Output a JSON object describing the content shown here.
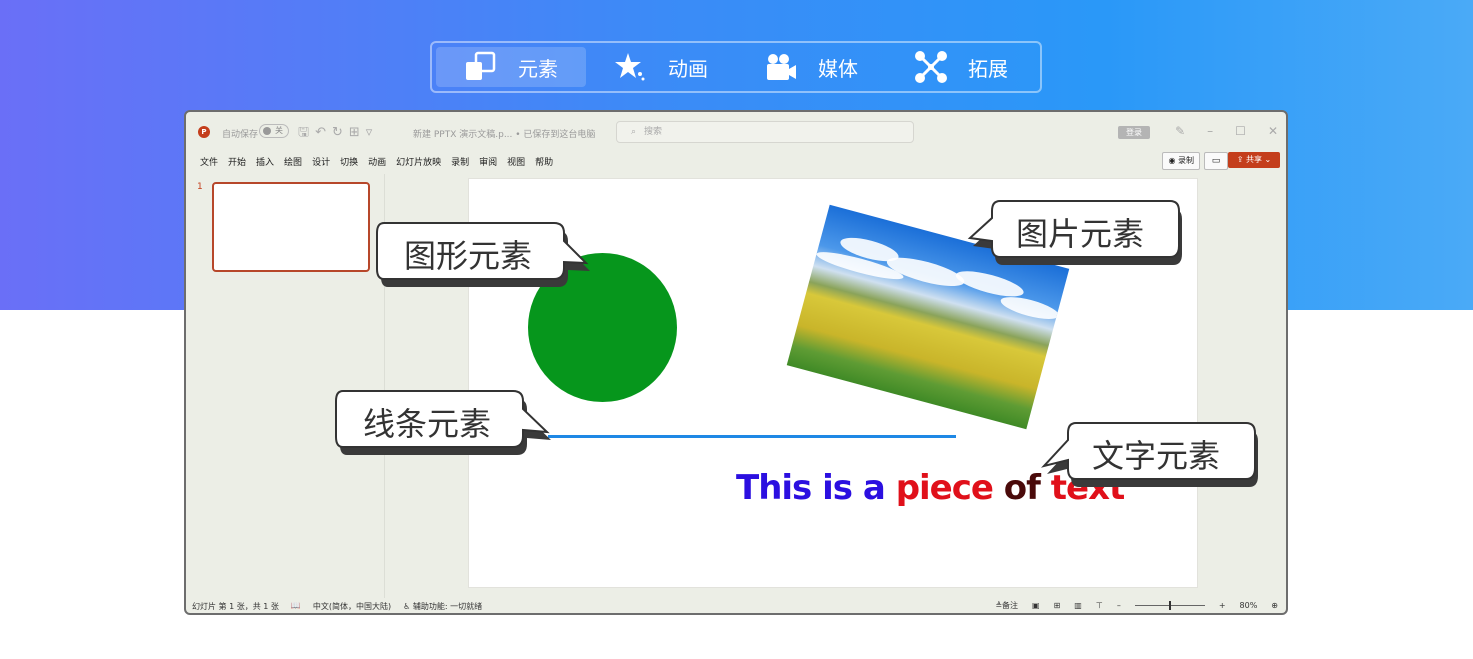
{
  "tabs": [
    {
      "label": "元素",
      "icon": "elements-icon",
      "active": true
    },
    {
      "label": "动画",
      "icon": "animation-star-icon",
      "active": false
    },
    {
      "label": "媒体",
      "icon": "video-camera-icon",
      "active": false
    },
    {
      "label": "拓展",
      "icon": "extension-network-icon",
      "active": false
    }
  ],
  "window": {
    "autosave_label": "自动保存",
    "autosave_state": "关",
    "doc_title": "新建 PPTX 演示文稿.p... • 已保存到这台电脑",
    "search_placeholder": "搜索",
    "login_label": "登录",
    "menu": [
      "文件",
      "开始",
      "插入",
      "绘图",
      "设计",
      "切换",
      "动画",
      "幻灯片放映",
      "录制",
      "审阅",
      "视图",
      "帮助"
    ],
    "record_label": "录制",
    "share_label": "共享",
    "slide_number": "1"
  },
  "status": {
    "slide_info": "幻灯片 第 1 张，共 1 张",
    "language": "中文(简体，中国大陆)",
    "accessibility": "辅助功能: 一切就绪",
    "notes": "备注",
    "zoom": "80%"
  },
  "slide": {
    "text_words": [
      {
        "text": "This",
        "color": "#2b0fe0"
      },
      {
        "text": "is",
        "color": "#2b0fe0"
      },
      {
        "text": "a",
        "color": "#2b0fe0"
      },
      {
        "text": "piece",
        "color": "#e0101a"
      },
      {
        "text": "of",
        "color": "#4a0a0a"
      },
      {
        "text": "text",
        "color": "#e0101a"
      }
    ],
    "circle_color": "#06961c",
    "line_color": "#1e88e5"
  },
  "callouts": {
    "shape": "图形元素",
    "image": "图片元素",
    "line": "线条元素",
    "text": "文字元素"
  },
  "colors": {
    "banner_start": "#6a6ff7",
    "banner_end": "#4aaaf7",
    "accent": "#c43e1c"
  }
}
